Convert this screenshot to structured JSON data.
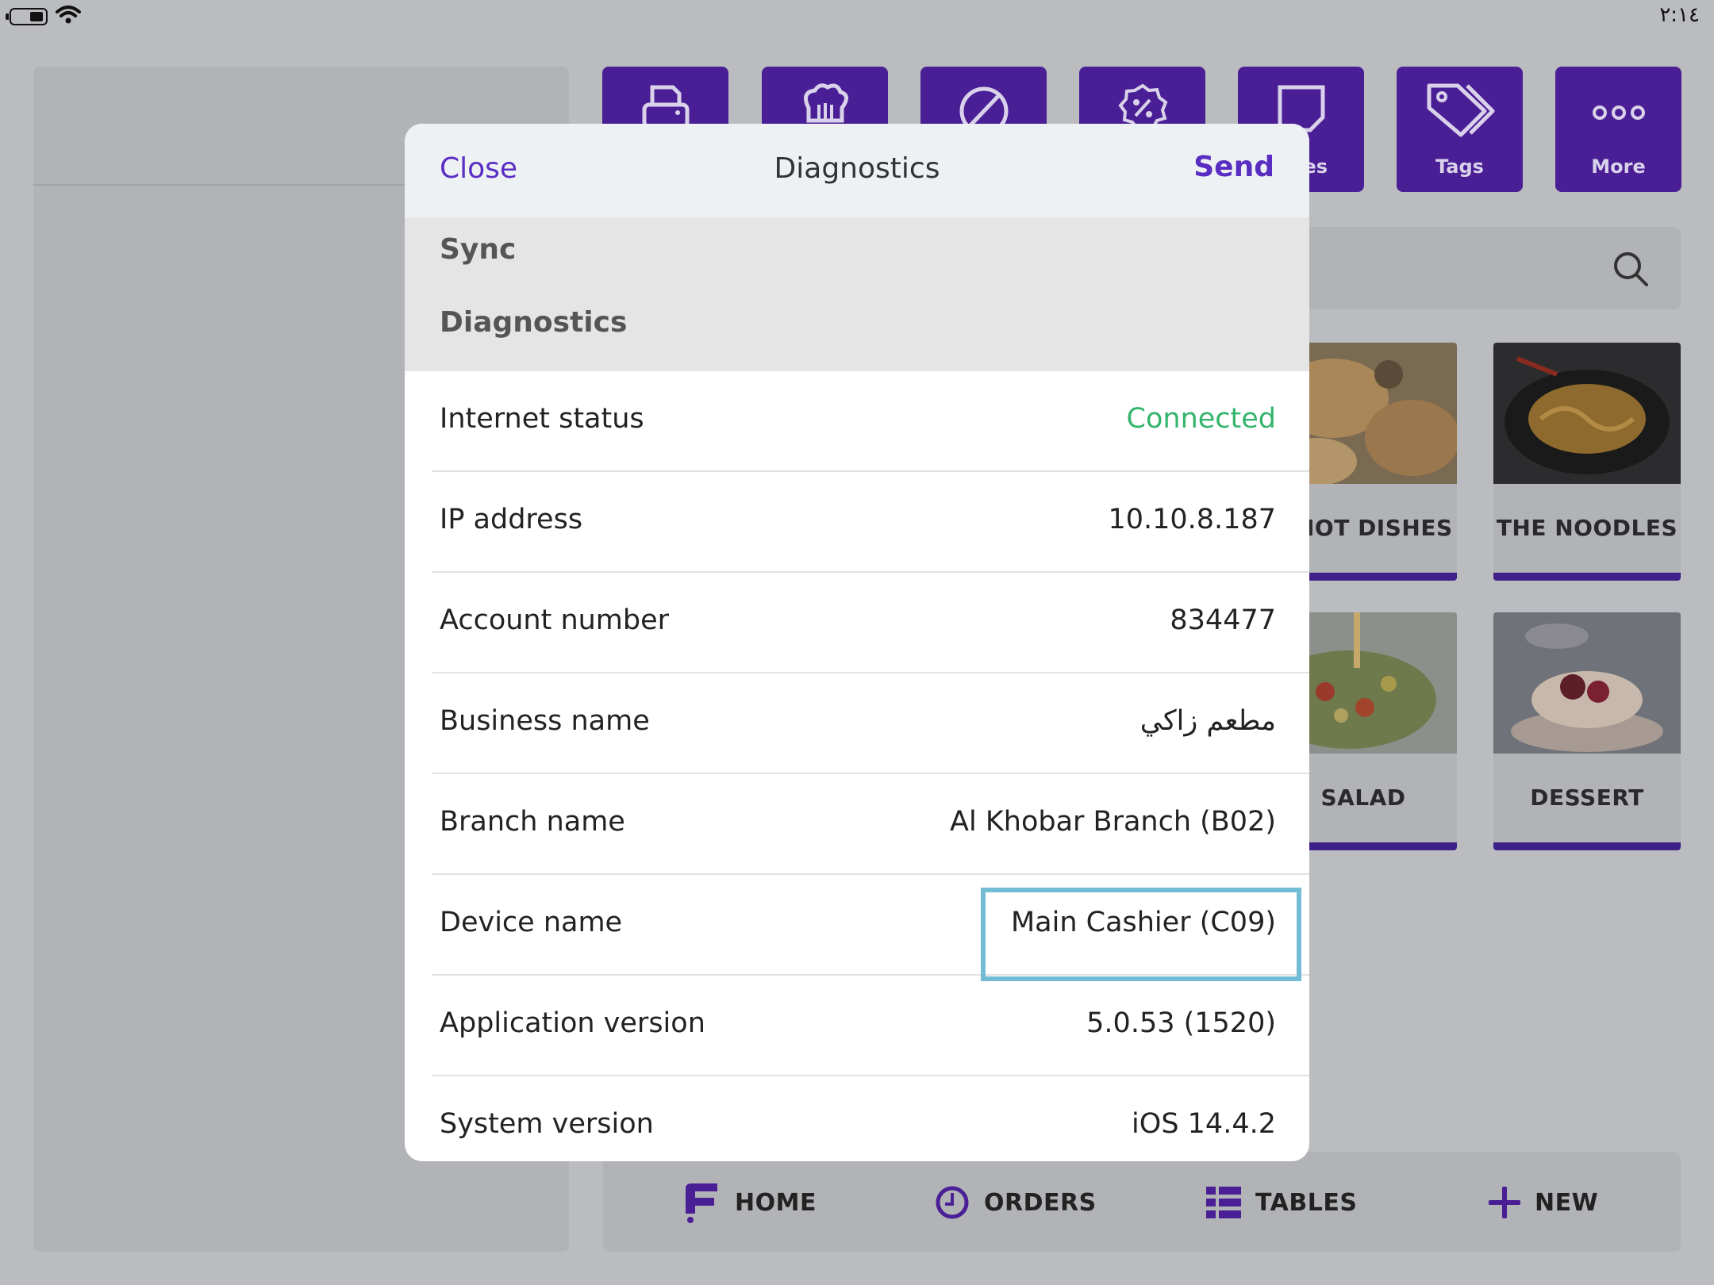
{
  "status_bar": {
    "time": "٢:١٤"
  },
  "toolbar": {
    "buttons": [
      {
        "label": "",
        "icon": "printer-icon"
      },
      {
        "label": "",
        "icon": "chef-hat-icon"
      },
      {
        "label": "",
        "icon": "void-icon"
      },
      {
        "label": "",
        "icon": "discount-icon"
      },
      {
        "label": "es",
        "icon": "notes-icon"
      },
      {
        "label": "Tags",
        "icon": "tag-icon"
      },
      {
        "label": "More",
        "icon": "more-icon"
      }
    ]
  },
  "categories": [
    {
      "label": "IOT DISHES"
    },
    {
      "label": "THE NOODLES"
    },
    {
      "label": "SALAD"
    },
    {
      "label": "DESSERT"
    }
  ],
  "bottom_nav": {
    "home": "HOME",
    "orders": "ORDERS",
    "tables": "TABLES",
    "new": "NEW"
  },
  "modal": {
    "close": "Close",
    "title": "Diagnostics",
    "send": "Send",
    "sections": [
      "Sync",
      "Diagnostics"
    ],
    "rows": [
      {
        "label": "Internet status",
        "value": "Connected"
      },
      {
        "label": "IP address",
        "value": "10.10.8.187"
      },
      {
        "label": "Account number",
        "value": "834477"
      },
      {
        "label": "Business name",
        "value": "مطعم زاكي"
      },
      {
        "label": "Branch name",
        "value": "Al Khobar Branch (B02)"
      },
      {
        "label": "Device name",
        "value": "Main Cashier (C09)"
      },
      {
        "label": "Application version",
        "value": "5.0.53 (1520)"
      },
      {
        "label": "System version",
        "value": "iOS 14.4.2"
      }
    ]
  },
  "colors": {
    "brand_purple": "#4a1f96",
    "link_purple": "#5a2dc2",
    "connected_green": "#34b46c",
    "highlight_blue": "#72bcd6"
  }
}
